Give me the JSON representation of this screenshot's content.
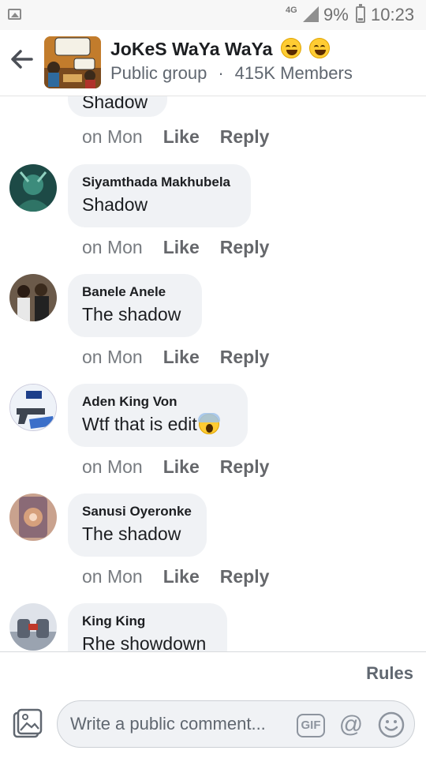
{
  "status_bar": {
    "network": "4G",
    "battery": "9%",
    "time": "10:23"
  },
  "header": {
    "group_name": "JoKeS WaYa WaYa",
    "group_type": "Public group",
    "separator": "·",
    "members": "415K Members"
  },
  "comments": [
    {
      "name": "",
      "text": "Shadow",
      "time": "on Mon",
      "like": "Like",
      "reply": "Reply"
    },
    {
      "name": "Siyamthada Makhubela",
      "text": "Shadow",
      "time": "on Mon",
      "like": "Like",
      "reply": "Reply"
    },
    {
      "name": "Banele Anele",
      "text": "The shadow",
      "time": "on Mon",
      "like": "Like",
      "reply": "Reply"
    },
    {
      "name": "Aden King Von",
      "text": "Wtf that is edit",
      "time": "on Mon",
      "like": "Like",
      "reply": "Reply"
    },
    {
      "name": "Sanusi Oyeronke",
      "text": "The shadow",
      "time": "on Mon",
      "like": "Like",
      "reply": "Reply"
    },
    {
      "name": "King King",
      "text": "Rhe showdown",
      "time": "",
      "like": "",
      "reply": ""
    }
  ],
  "composer": {
    "rules": "Rules",
    "placeholder": "Write a public comment...",
    "gif": "GIF",
    "at": "@"
  },
  "colors": {
    "bubble": "#f0f2f5",
    "muted_text": "#65676b",
    "primary_text": "#1c1e21"
  }
}
